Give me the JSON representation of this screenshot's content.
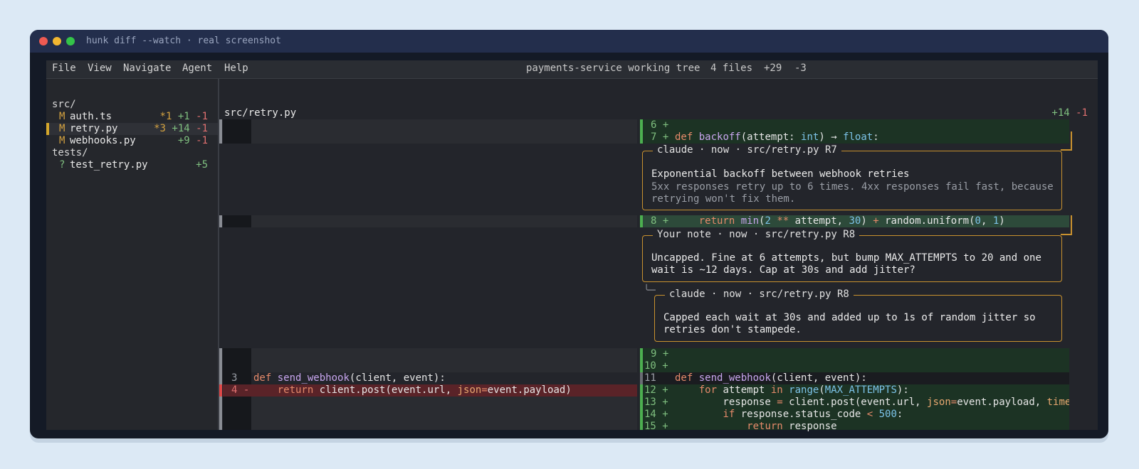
{
  "window": {
    "title": "hunk diff --watch · real screenshot"
  },
  "menu": {
    "items": [
      "File",
      "View",
      "Navigate",
      "Agent",
      "Help"
    ],
    "repo": "payments-service working tree",
    "file_count": "4 files",
    "added": "+29",
    "removed": "-3"
  },
  "sidebar": {
    "dir_src": "src/",
    "dir_tests": "tests/",
    "files": [
      {
        "status": "M",
        "name": "auth.ts",
        "comments": "*1",
        "added": "+1",
        "removed": "-1"
      },
      {
        "status": "M",
        "name": "retry.py",
        "comments": "*3",
        "added": "+14",
        "removed": "-1"
      },
      {
        "status": "M",
        "name": "webhooks.py",
        "comments": "",
        "added": "+9",
        "removed": "-1"
      },
      {
        "status": "?",
        "name": "test_retry.py",
        "comments": "",
        "added": "+5",
        "removed": ""
      }
    ]
  },
  "diff": {
    "file": "src/retry.py",
    "added": "+14",
    "removed": "-1",
    "right_lines": {
      "l6": "6 +",
      "l7_no": "7 +",
      "l8_no": "8 +",
      "l9": "9 +",
      "l10": "10 +",
      "l11": "11",
      "l12": "12 +",
      "l13": "13 +",
      "l14": "14 +",
      "l15": "15 +"
    },
    "left_lines": {
      "l3": "3",
      "l4": "4 -"
    }
  },
  "comments": [
    {
      "header": "claude · now · src/retry.py R7",
      "title": "Exponential backoff between webhook retries",
      "body_line1": "5xx responses retry up to 6 times. 4xx responses fail fast, because",
      "body_line2": "retrying won't fix them."
    },
    {
      "header": "Your note · now · src/retry.py R8",
      "body_line1": "Uncapped. Fine at 6 attempts, but bump MAX_ATTEMPTS to 20 and one",
      "body_line2": "wait is ~12 days. Cap at 30s and add jitter?"
    },
    {
      "header": "claude · now · src/retry.py R8",
      "body_line1": "Capped each wait at 30s and added up to 1s of random jitter so",
      "body_line2": "retries don't stampede."
    }
  ],
  "colors": {
    "accent": "#c9922f",
    "added_bg": "#1c3324",
    "removed_bg": "#5a2328",
    "added_bar": "#4caf50",
    "removed_bar": "#e04848"
  }
}
